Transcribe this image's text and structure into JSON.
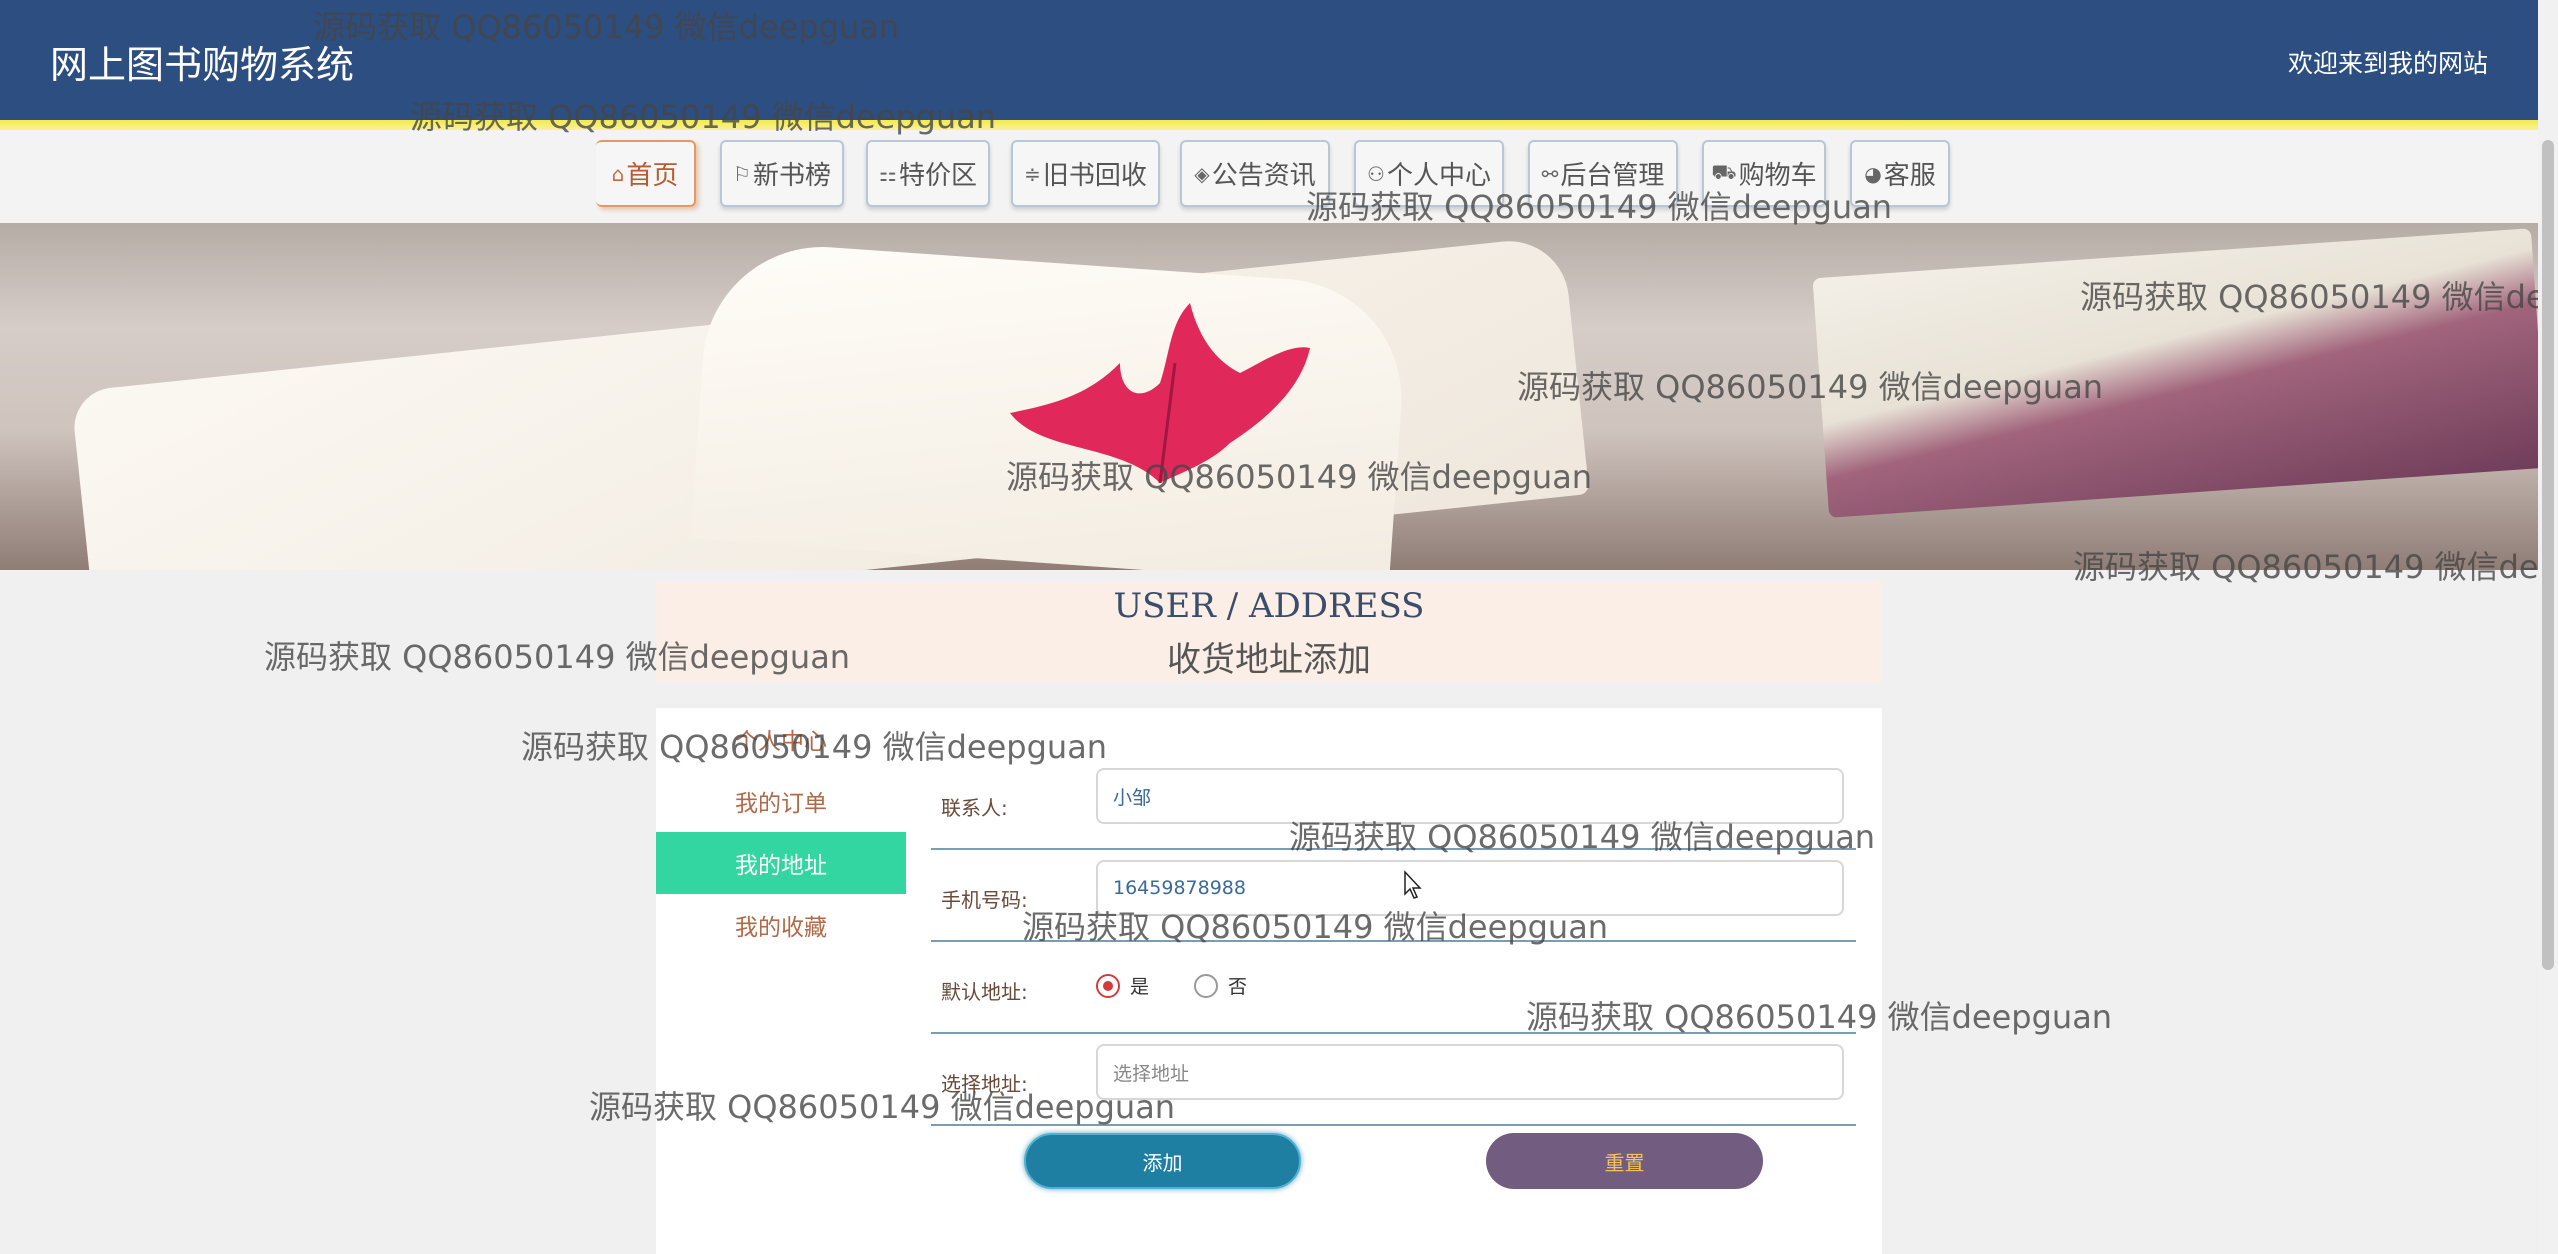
{
  "header": {
    "site_title": "网上图书购物系统",
    "welcome": "欢迎来到我的网站"
  },
  "nav": [
    {
      "icon": "⌂",
      "label": "首页"
    },
    {
      "icon": "⚐",
      "label": "新书榜"
    },
    {
      "icon": "⚏",
      "label": "特价区"
    },
    {
      "icon": "≑",
      "label": "旧书回收"
    },
    {
      "icon": "◈",
      "label": "公告资讯"
    },
    {
      "icon": "⚇",
      "label": "个人中心"
    },
    {
      "icon": "⚯",
      "label": "后台管理"
    },
    {
      "icon": "⛟",
      "label": "购物车"
    },
    {
      "icon": "◕",
      "label": "客服"
    }
  ],
  "banner": {
    "slide_count": 3,
    "active_slide": 2
  },
  "section": {
    "title_en": "USER / ADDRESS",
    "title_cn": "收货地址添加"
  },
  "side_menu": [
    {
      "label": "个人中心"
    },
    {
      "label": "我的订单"
    },
    {
      "label": "我的地址"
    },
    {
      "label": "我的收藏"
    }
  ],
  "form": {
    "contact_label": "联系人:",
    "contact_value": "小邹",
    "phone_label": "手机号码:",
    "phone_value": "16459878988",
    "default_label": "默认地址:",
    "default_yes": "是",
    "default_no": "否",
    "default_selected": "是",
    "address_label": "选择地址:",
    "address_placeholder": "选择地址",
    "add_button": "添加",
    "reset_button": "重置"
  },
  "watermark": "源码获取 QQ86050149 微信deepguan",
  "colors": {
    "header_bg": "#2c4e80",
    "accent_stripe": "#f3ea4a",
    "active_menu": "#33d6a0",
    "add_button": "#1e7fa3",
    "reset_button": "#725c80"
  }
}
